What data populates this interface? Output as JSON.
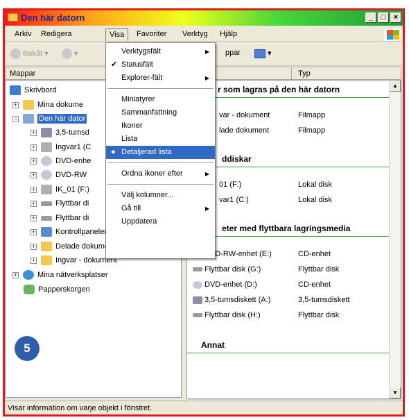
{
  "window": {
    "title": "Den här datorn"
  },
  "menubar": [
    "Arkiv",
    "Redigera",
    "Visa",
    "Favoriter",
    "Verktyg",
    "Hjälp"
  ],
  "toolbar": {
    "back": "Bakåt",
    "folders": "ppar"
  },
  "left_pane": {
    "header": "Mappar",
    "tree": [
      {
        "label": "Skrivbord",
        "expander": ""
      },
      {
        "label": "Mina dokume",
        "expander": "+"
      },
      {
        "label": "Den här dator",
        "expander": "−",
        "selected": true
      },
      {
        "label": "3,5-tumsd",
        "expander": "+"
      },
      {
        "label": "Ingvar1 (C",
        "expander": "+"
      },
      {
        "label": "DVD-enhe",
        "expander": "+"
      },
      {
        "label": "DVD-RW",
        "expander": "+"
      },
      {
        "label": "IK_01 (F:)",
        "expander": "+"
      },
      {
        "label": "Flyttbar di",
        "expander": "+"
      },
      {
        "label": "Flyttbar di",
        "expander": "+"
      },
      {
        "label": "Kontrollpanelen",
        "expander": "+"
      },
      {
        "label": "Delade dokument",
        "expander": "+"
      },
      {
        "label": "Ingvar - dokument",
        "expander": "+"
      },
      {
        "label": "Mina nätverksplatser",
        "expander": "+"
      },
      {
        "label": "Papperskorgen",
        "expander": ""
      }
    ]
  },
  "right_pane": {
    "columns": [
      "",
      "Typ"
    ],
    "groups": [
      {
        "title": "r som lagras på den här datorn",
        "rows": [
          [
            "var - dokument",
            "Filmapp"
          ],
          [
            "lade dokument",
            "Filmapp"
          ]
        ]
      },
      {
        "title": "ddiskar",
        "rows": [
          [
            "01 (F:)",
            "Lokal disk"
          ],
          [
            "var1 (C:)",
            "Lokal disk"
          ]
        ]
      },
      {
        "title": "eter med flyttbara lagringsmedia",
        "rows": []
      },
      {
        "title": "",
        "rows": [
          [
            "DVD-RW-enhet (E:)",
            "CD-enhet"
          ],
          [
            "Flyttbar disk (G:)",
            "Flyttbar disk"
          ],
          [
            "DVD-enhet (D:)",
            "CD-enhet"
          ],
          [
            "3,5-tumsdiskett (A:)",
            "3,5-tumsdiskett"
          ],
          [
            "Flyttbar disk (H:)",
            "Flyttbar disk"
          ]
        ]
      },
      {
        "title": "Annat",
        "rows": []
      }
    ]
  },
  "view_menu": {
    "items": [
      {
        "label": "Verktygsfält",
        "submenu": true
      },
      {
        "label": "Statusfält",
        "checked": true
      },
      {
        "label": "Explorer-fält",
        "submenu": true
      },
      {
        "label": "Miniatyrer"
      },
      {
        "label": "Sammanfattning"
      },
      {
        "label": "Ikoner"
      },
      {
        "label": "Lista"
      },
      {
        "label": "Detaljerad lista",
        "bullet": true,
        "highlighted": true
      },
      {
        "label": "Ordna ikoner efter",
        "submenu": true
      },
      {
        "label": "Välj kolumner..."
      },
      {
        "label": "Gå till",
        "submenu": true
      },
      {
        "label": "Uppdatera"
      }
    ]
  },
  "statusbar": {
    "text": "Visar information om varje objekt i fönstret."
  },
  "badge": "5",
  "colors": {
    "selection": "#316ac5",
    "frame": "#e11b1b",
    "badge": "#2f5ea8"
  }
}
